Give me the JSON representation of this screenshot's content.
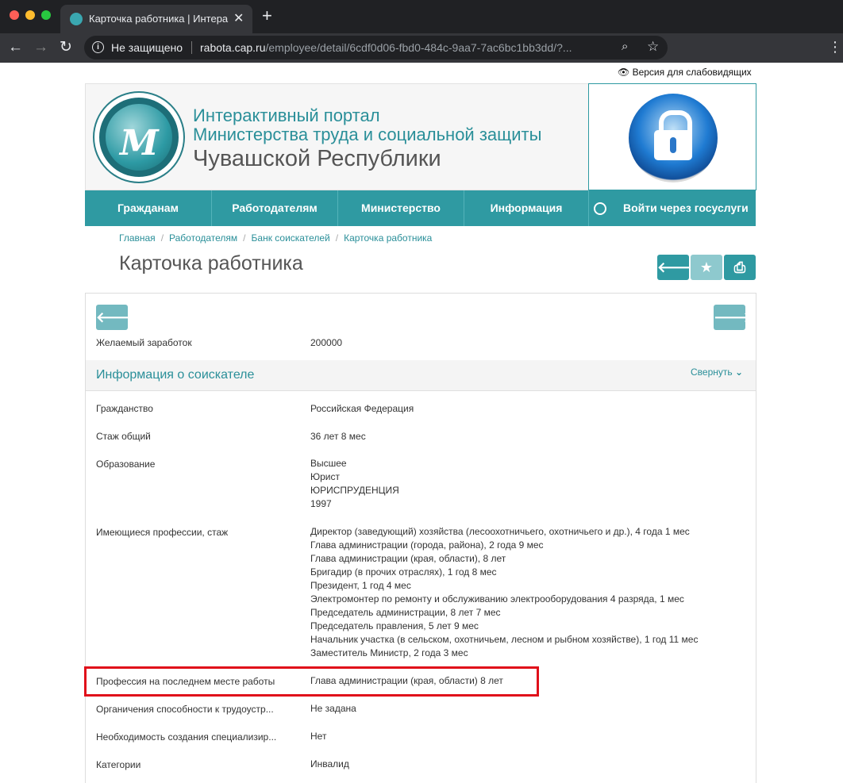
{
  "browser": {
    "tab_title": "Карточка работника | Интерактивный портал",
    "insecure_label": "Не защищено",
    "url_host": "rabota.cap.ru",
    "url_path": "/employee/detail/6cdf0d06-fbd0-484c-9aa7-7ac6bc1bb3dd/?..."
  },
  "accessibility_link": "Версия для слабовидящих",
  "header": {
    "line1": "Интерактивный портал",
    "line2": "Министерства труда и социальной защиты",
    "line3": "Чувашской Республики"
  },
  "nav": {
    "items": [
      "Гражданам",
      "Работодателям",
      "Министерство",
      "Информация"
    ],
    "gosuslugi": "Войти через госуслуги"
  },
  "breadcrumbs": [
    "Главная",
    "Работодателям",
    "Банк соискателей",
    "Карточка работника"
  ],
  "page_title": "Карточка работника",
  "salary": {
    "label": "Желаемый заработок",
    "value": "200000"
  },
  "section": {
    "title": "Информация о соискателе",
    "collapse_label": "Свернуть"
  },
  "fields": {
    "citizenship": {
      "label": "Гражданство",
      "value": "Российская Федерация"
    },
    "experience": {
      "label": "Стаж общий",
      "value": "36 лет 8 мес"
    },
    "education": {
      "label": "Образование",
      "lines": [
        "Высшее",
        "Юрист",
        "ЮРИСПРУДЕНЦИЯ",
        "1997"
      ]
    },
    "professions": {
      "label": "Имеющиеся профессии, стаж",
      "lines": [
        "Директор (заведующий) хозяйства (лесоохотничьего, охотничьего и др.),  4 года 1 мес",
        "Глава администрации (города, района),  2 года 9 мес",
        "Глава администрации (края, области),  8 лет",
        "Бригадир (в прочих отраслях),  1 год 8 мес",
        "Президент,  1 год 4 мес",
        "Электромонтер по ремонту и обслуживанию электрооборудования 4 разряда,  1 мес",
        "Председатель администрации,  8 лет 7 мес",
        "Председатель правления,  5 лет 9 мес",
        "Начальник участка (в сельском, охотничьем, лесном и рыбном хозяйстве),  1 год 11 мес",
        "Заместитель Министр,  2 года 3 мес"
      ]
    },
    "last_profession": {
      "label": "Профессия на последнем месте работы",
      "value": "Глава администрации (края, области)  8 лет"
    },
    "limitations": {
      "label": "Органичения способности к трудоустр...",
      "value": "Не задана"
    },
    "special_workplace": {
      "label": "Необходимость создания специализир...",
      "value": "Нет"
    },
    "categories": {
      "label": "Категории",
      "value": "Инвалид"
    }
  },
  "colors": {
    "accent": "#2f9aa2",
    "highlight": "#e0101a"
  }
}
